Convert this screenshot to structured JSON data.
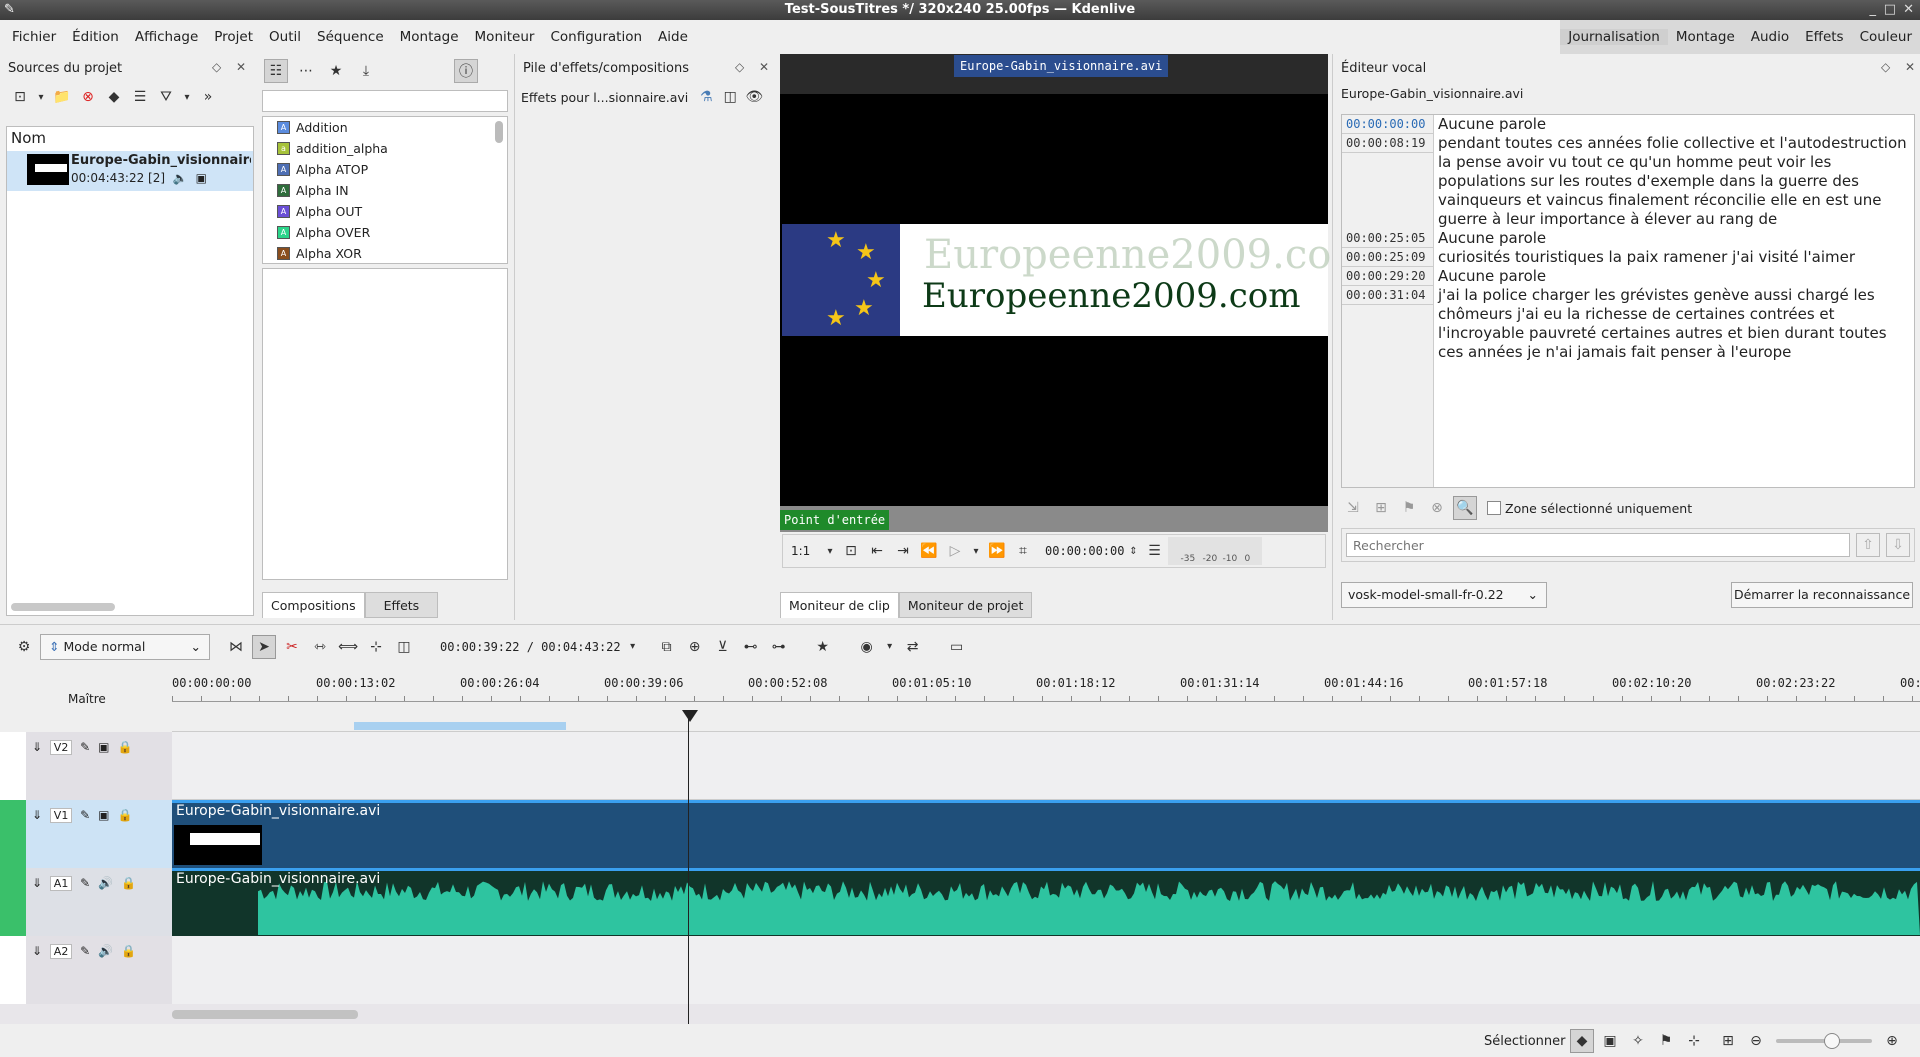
{
  "window": {
    "title": "Test-SousTitres */ 320x240 25.00fps — Kdenlive"
  },
  "menu": [
    "Fichier",
    "Édition",
    "Affichage",
    "Projet",
    "Outil",
    "Séquence",
    "Montage",
    "Moniteur",
    "Configuration",
    "Aide"
  ],
  "workspaces": [
    "Journalisation",
    "Montage",
    "Audio",
    "Effets",
    "Couleur"
  ],
  "project_bin": {
    "title": "Sources du projet",
    "column_name": "Nom",
    "clip": {
      "name": "Europe-Gabin_visionnaire.avi",
      "duration": "00:04:43:22 [2]"
    }
  },
  "effects": {
    "items": [
      {
        "label": "Addition",
        "color": "#5b8cde"
      },
      {
        "label": "addition_alpha",
        "color": "#a6c23a"
      },
      {
        "label": "Alpha ATOP",
        "color": "#4e6fb4"
      },
      {
        "label": "Alpha IN",
        "color": "#2f6d3c"
      },
      {
        "label": "Alpha OUT",
        "color": "#6a4fd6"
      },
      {
        "label": "Alpha OVER",
        "color": "#2bd58a"
      },
      {
        "label": "Alpha XOR",
        "color": "#8a4e1e"
      }
    ],
    "tabs": [
      "Compositions",
      "Effets"
    ]
  },
  "effect_stack": {
    "title": "Pile d'effets/compositions",
    "target": "Effets pour l...sionnaire.avi"
  },
  "monitor": {
    "overlay_title": "Europe-Gabin_visionnaire.avi",
    "logo_text": "Europeenne2009.com",
    "in_point": "Point d'entrée",
    "zoom": "1:1",
    "timecode": "00:00:00:00",
    "meter_labels": [
      "-35",
      "-20",
      "-10",
      "0"
    ],
    "tabs": [
      "Moniteur de clip",
      "Moniteur de projet"
    ]
  },
  "speech": {
    "title": "Éditeur vocal",
    "clip": "Europe-Gabin_visionnaire.avi",
    "rows": [
      {
        "tc": "00:00:00:00",
        "text": "Aucune parole"
      },
      {
        "tc": "00:00:08:19",
        "text": "pendant toutes ces années folie collective et l'autodestruction la pense avoir vu tout ce qu'un homme peut voir les populations sur les routes d'exemple dans la guerre des vainqueurs et vaincus finalement réconcilie elle en est une guerre à leur importance à élever au rang de"
      },
      {
        "tc": "00:00:25:05",
        "text": "Aucune parole"
      },
      {
        "tc": "00:00:25:09",
        "text": "curiosités touristiques la paix ramener j'ai visité l'aimer"
      },
      {
        "tc": "00:00:29:20",
        "text": "Aucune parole"
      },
      {
        "tc": "00:00:31:04",
        "text": "j'ai la police charger les grévistes genève aussi chargé les chômeurs j'ai eu la richesse de certaines contrées et l'incroyable pauvreté certaines autres et bien durant toutes ces années je n'ai jamais fait penser à l'europe"
      }
    ],
    "zone_label": "Zone sélectionné uniquement",
    "search_placeholder": "Rechercher",
    "model": "vosk-model-small-fr-0.22",
    "start_btn": "Démarrer la reconnaissance"
  },
  "timeline": {
    "mode": "Mode normal",
    "position": "00:00:39:22 / 00:04:43:22",
    "master": "Maître",
    "ruler": [
      "00:00:00:00",
      "00:00:13:02",
      "00:00:26:04",
      "00:00:39:06",
      "00:00:52:08",
      "00:01:05:10",
      "00:01:18:12",
      "00:01:31:14",
      "00:01:44:16",
      "00:01:57:18",
      "00:02:10:20",
      "00:02:23:22",
      "00:"
    ],
    "tracks": [
      "V2",
      "V1",
      "A1",
      "A2"
    ],
    "v1_clip": "Europe-Gabin_visionnaire.avi",
    "a1_clip": "Europe-Gabin_visionnaire.avi"
  },
  "status": {
    "select_label": "Sélectionner"
  }
}
